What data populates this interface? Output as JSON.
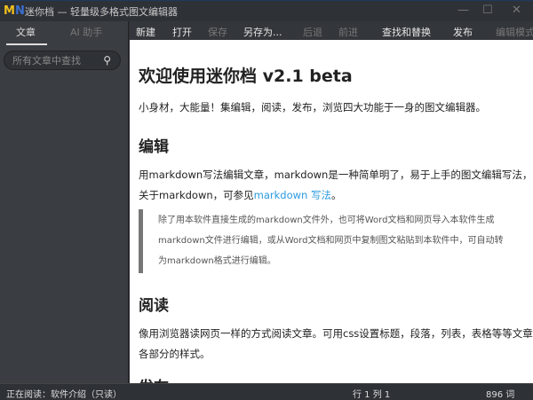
{
  "window": {
    "title": "迷你档 — 轻量级多格式图文编辑器",
    "logo": "MN"
  },
  "sidebar": {
    "tabs": [
      {
        "label": "文章",
        "active": true
      },
      {
        "label": "AI 助手",
        "active": false
      }
    ],
    "search_placeholder": "所有文章中查找"
  },
  "toolbar": {
    "items": [
      {
        "label": "新建",
        "enabled": true
      },
      {
        "label": "打开",
        "enabled": true
      },
      {
        "label": "保存",
        "enabled": false
      },
      {
        "label": "另存为...",
        "enabled": true
      },
      {
        "label": "后退",
        "enabled": false
      },
      {
        "label": "前进",
        "enabled": false
      },
      {
        "label": "查找和替换",
        "enabled": true
      },
      {
        "label": "发布",
        "enabled": true
      },
      {
        "label": "编辑模式",
        "enabled": false
      }
    ]
  },
  "doc": {
    "h1": "欢迎使用迷你档 v2.1 beta",
    "intro": "小身材，大能量！集编辑，阅读，发布，浏览四大功能于一身的图文编辑器。",
    "h2_edit": "编辑",
    "edit_p1": "用markdown写法编辑文章，markdown是一种简单明了，易于上手的图文编辑写法，",
    "edit_p2": "关于markdown，可参见",
    "edit_link": "markdown 写法",
    "edit_p2_end": "。",
    "quote": [
      "除了用本软件直接生成的markdown文件外，也可将Word文档和网页导入本软件生成",
      "markdown文件进行编辑，或从Word文档和网页中复制图文粘贴到本软件中，可自动转",
      "为markdown格式进行编辑。"
    ],
    "h2_read": "阅读",
    "read_p1": "像用浏览器读网页一样的方式阅读文章。可用css设置标题，段落，列表，表格等等文章",
    "read_p2": "各部分的样式。",
    "h2_cut": "发布"
  },
  "status": {
    "reading": "正在阅读：软件介绍（只读）",
    "position": "行 1 列 1",
    "words": "896 词"
  }
}
